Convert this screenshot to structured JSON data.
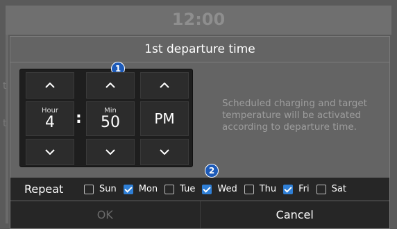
{
  "clock": "12:00",
  "dialog": {
    "title": "1st departure time",
    "description": "Scheduled charging and target temperature will be activated according to departure time."
  },
  "picker": {
    "hour": {
      "label": "Hour",
      "value": "4"
    },
    "colon": ":",
    "minute": {
      "label": "Min",
      "value": "50"
    },
    "ampm": "PM"
  },
  "callouts": [
    "1",
    "2"
  ],
  "repeat": {
    "label": "Repeat",
    "days": [
      {
        "label": "Sun",
        "checked": false
      },
      {
        "label": "Mon",
        "checked": true
      },
      {
        "label": "Tue",
        "checked": false
      },
      {
        "label": "Wed",
        "checked": true
      },
      {
        "label": "Thu",
        "checked": false
      },
      {
        "label": "Fri",
        "checked": true
      },
      {
        "label": "Sat",
        "checked": false
      }
    ]
  },
  "buttons": {
    "ok": "OK",
    "cancel": "Cancel"
  },
  "icons": {
    "up": "chevron-up-icon",
    "down": "chevron-down-icon"
  }
}
